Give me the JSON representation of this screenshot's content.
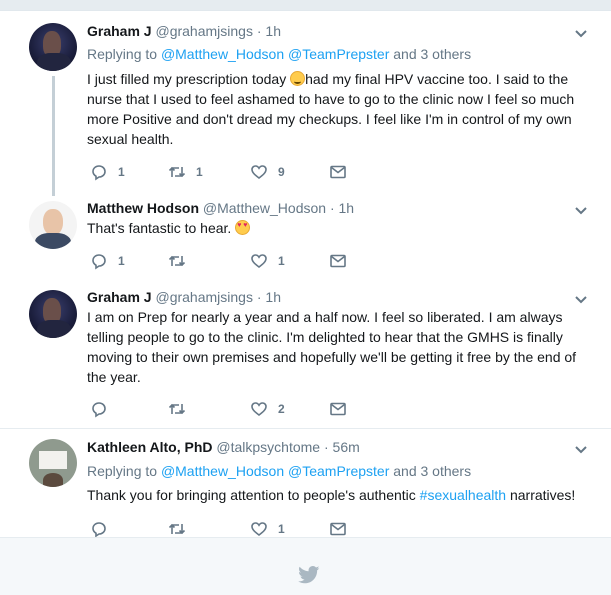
{
  "tweets": [
    {
      "name": "Graham J",
      "handle": "@grahamjsings",
      "dot": "·",
      "time": "1h",
      "replying_to": {
        "prefix": "Replying to",
        "mention1": "@Matthew_Hodson",
        "mention2": "@TeamPrepster",
        "others": "and 3 others"
      },
      "text_part1": "I just filled my prescription today ",
      "emoji": "smiling-face-emoji",
      "text_part2": "had my final HPV vaccine too.  I said to the nurse that I used to feel ashamed to have to go to the clinic now I feel so much more Positive and don't dread my checkups. I feel like I'm in control of my own sexual health.",
      "counts": {
        "reply": "1",
        "retweet": "1",
        "like": "9"
      }
    },
    {
      "name": "Matthew Hodson",
      "handle": "@Matthew_Hodson",
      "dot": "·",
      "time": "1h",
      "text_part1": "That's fantastic to hear. ",
      "emoji": "heart-eyes-emoji",
      "counts": {
        "reply": "1",
        "retweet": "",
        "like": "1"
      }
    },
    {
      "name": "Graham J",
      "handle": "@grahamjsings",
      "dot": "·",
      "time": "1h",
      "text_part1": "I am on Prep for nearly a year and a half now. I feel so liberated. I am always telling people to go to the clinic. I'm delighted to hear that the GMHS is finally moving to their own premises and hopefully we'll be getting it free by the end of the year.",
      "counts": {
        "reply": "",
        "retweet": "",
        "like": "2"
      }
    },
    {
      "name": "Kathleen Alto, PhD",
      "handle": "@talkpsychtome",
      "dot": "·",
      "time": "56m",
      "replying_to": {
        "prefix": "Replying to",
        "mention1": "@Matthew_Hodson",
        "mention2": "@TeamPrepster",
        "others": "and 3 others"
      },
      "text_before": "Thank you for bringing attention to people's authentic ",
      "hashtag": "#sexualhealth",
      "text_after": " narratives!",
      "counts": {
        "reply": "",
        "retweet": "",
        "like": "1"
      }
    }
  ],
  "icons": {
    "reply": "reply-icon",
    "retweet": "retweet-icon",
    "like": "heart-icon",
    "dm": "envelope-icon",
    "more": "chevron-down-icon",
    "footer": "twitter-bird-icon"
  },
  "colors": {
    "link": "#1da1f2",
    "secondary_text": "#657786",
    "thread_line": "#c4cfd6",
    "footer_bg": "#f5f8fa"
  }
}
